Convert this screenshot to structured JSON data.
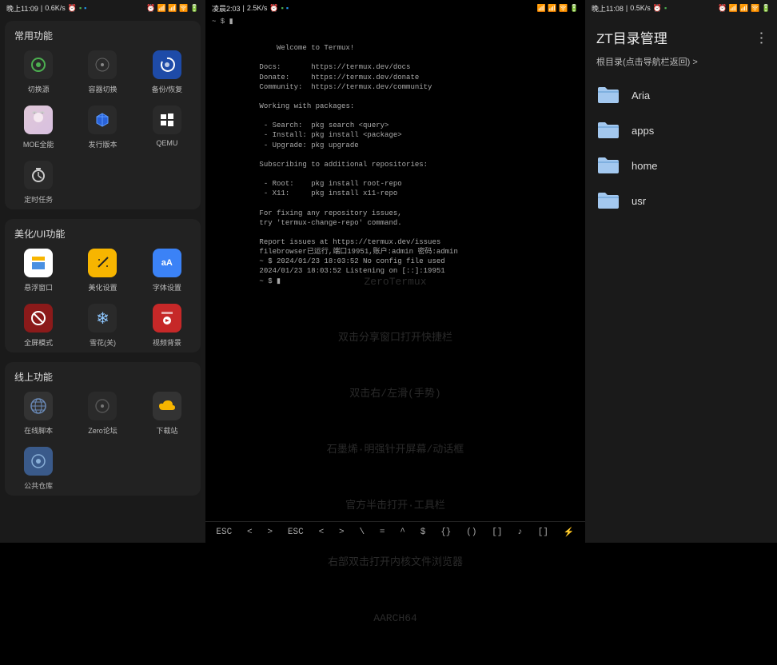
{
  "left": {
    "status": {
      "time": "晚上11:09",
      "net": "0.6K/s",
      "icons_right": "⏰ 📶 📶 🛜 🔋"
    },
    "sections": [
      {
        "title": "常用功能",
        "items": [
          {
            "label": "切换源",
            "icon": "ring-green"
          },
          {
            "label": "容器切换",
            "icon": "disc"
          },
          {
            "label": "备份/恢复",
            "icon": "swirl-blue"
          },
          {
            "label": "MOE全能",
            "icon": "avatar"
          },
          {
            "label": "发行版本",
            "icon": "cube-blue"
          },
          {
            "label": "QEMU",
            "icon": "windows"
          },
          {
            "label": "定时任务",
            "icon": "timer"
          }
        ]
      },
      {
        "title": "美化/UI功能",
        "items": [
          {
            "label": "悬浮窗口",
            "icon": "window-yellow"
          },
          {
            "label": "美化设置",
            "icon": "wand-yellow"
          },
          {
            "label": "字体设置",
            "icon": "font-blue"
          },
          {
            "label": "全屏模式",
            "icon": "noentry-red"
          },
          {
            "label": "雪花(关)",
            "icon": "snow"
          },
          {
            "label": "视频背景",
            "icon": "play-red"
          }
        ]
      },
      {
        "title": "线上功能",
        "items": [
          {
            "label": "在线脚本",
            "icon": "globe"
          },
          {
            "label": "Zero论坛",
            "icon": "disc-dark"
          },
          {
            "label": "下载站",
            "icon": "cloud-yellow"
          },
          {
            "label": "公共仓库",
            "icon": "disc-blue"
          }
        ]
      }
    ]
  },
  "center": {
    "status": {
      "time": "凌晨2:03",
      "net": "2.5K/s",
      "icons_right": "📶 📶 🛜 🔋"
    },
    "prompt_top": "~ $ ▮",
    "terminal_lines": "           Welcome to Termux!\n\n           Docs:       https://termux.dev/docs\n           Donate:     https://termux.dev/donate\n           Community:  https://termux.dev/community\n\n           Working with packages:\n\n            - Search:  pkg search <query>\n            - Install: pkg install <package>\n            - Upgrade: pkg upgrade\n\n           Subscribing to additional repositories:\n\n            - Root:    pkg install root-repo\n            - X11:     pkg install x11-repo\n\n           For fixing any repository issues,\n           try 'termux-change-repo' command.\n\n           Report issues at https://termux.dev/issues\n           filebrowser已运行,端口19951,账户:admin 密码:admin\n           ~ $ 2024/01/23 18:03:52 No config file used\n           2024/01/23 18:03:52 Listening on [::]:19951\n           ~ $ ▮",
    "watermark": [
      "ZeroTermux",
      "双击分享窗口打开快捷栏",
      "双击右/左滑(手势)",
      "石墨烯·明强针开屏幕/动话框",
      "官方半击打开·工具栏",
      "右部双击打开内核文件浏览器",
      "AARCH64"
    ],
    "keys": [
      "ESC",
      "<",
      ">",
      "ESC",
      "<",
      ">",
      "\\",
      "=",
      "^",
      "$",
      "{}",
      "()",
      "[]",
      "♪",
      "[]",
      "⚡"
    ]
  },
  "right": {
    "status": {
      "time": "晚上11:08",
      "net": "0.5K/s",
      "icons_right": "⏰ 📶 📶 🛜 🔋"
    },
    "title": "ZT目录管理",
    "breadcrumb": "根目录(点击导航栏返回) >",
    "folders": [
      "Aria",
      "apps",
      "home",
      "usr"
    ]
  }
}
